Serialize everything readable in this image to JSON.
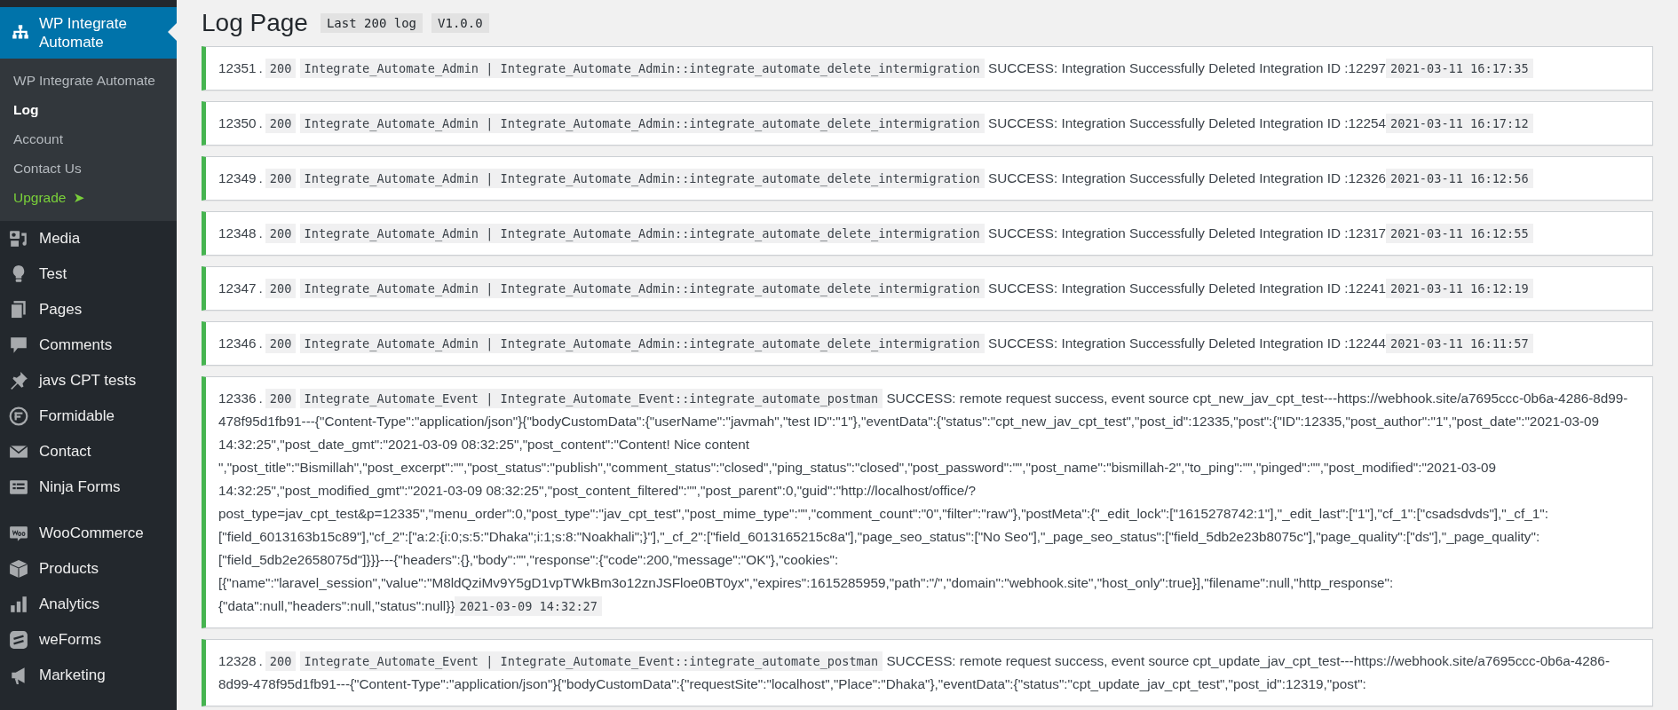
{
  "sidebar": {
    "current": {
      "label": "WP Integrate Automate",
      "selected": true
    },
    "submenu": [
      {
        "label": "WP Integrate Automate",
        "selected": false,
        "kind": "link"
      },
      {
        "label": "Log",
        "selected": true,
        "kind": "link"
      },
      {
        "label": "Account",
        "selected": false,
        "kind": "link"
      },
      {
        "label": "Contact Us",
        "selected": false,
        "kind": "link"
      },
      {
        "label": "Upgrade",
        "selected": false,
        "kind": "upgrade",
        "arrow": "➤"
      }
    ],
    "items": [
      {
        "label": "Media",
        "selected": false
      },
      {
        "label": "Test",
        "selected": false
      },
      {
        "label": "Pages",
        "selected": false
      },
      {
        "label": "Comments",
        "selected": false
      },
      {
        "label": "javs CPT tests",
        "selected": false
      },
      {
        "label": "Formidable",
        "selected": false
      },
      {
        "label": "Contact",
        "selected": false
      },
      {
        "label": "Ninja Forms",
        "selected": false
      },
      {
        "label": "WooCommerce",
        "selected": false,
        "separator_before": true
      },
      {
        "label": "Products",
        "selected": false
      },
      {
        "label": "Analytics",
        "selected": false
      },
      {
        "label": "weForms",
        "selected": false
      },
      {
        "label": "Marketing",
        "selected": false
      }
    ]
  },
  "page": {
    "title": "Log Page",
    "badges": [
      "Last 200 log",
      "V1.0.0"
    ]
  },
  "logs": [
    {
      "id": "12351",
      "sep": ".",
      "code": "200",
      "source": "Integrate_Automate_Admin | Integrate_Automate_Admin::integrate_automate_delete_intermigration",
      "message": "SUCCESS: Integration Successfully Deleted Integration ID :12297",
      "time": "2021-03-11 16:17:35"
    },
    {
      "id": "12350",
      "sep": ".",
      "code": "200",
      "source": "Integrate_Automate_Admin | Integrate_Automate_Admin::integrate_automate_delete_intermigration",
      "message": "SUCCESS: Integration Successfully Deleted Integration ID :12254",
      "time": "2021-03-11 16:17:12"
    },
    {
      "id": "12349",
      "sep": ".",
      "code": "200",
      "source": "Integrate_Automate_Admin | Integrate_Automate_Admin::integrate_automate_delete_intermigration",
      "message": "SUCCESS: Integration Successfully Deleted Integration ID :12326",
      "time": "2021-03-11 16:12:56"
    },
    {
      "id": "12348",
      "sep": ".",
      "code": "200",
      "source": "Integrate_Automate_Admin | Integrate_Automate_Admin::integrate_automate_delete_intermigration",
      "message": "SUCCESS: Integration Successfully Deleted Integration ID :12317",
      "time": "2021-03-11 16:12:55"
    },
    {
      "id": "12347",
      "sep": ".",
      "code": "200",
      "source": "Integrate_Automate_Admin | Integrate_Automate_Admin::integrate_automate_delete_intermigration",
      "message": "SUCCESS: Integration Successfully Deleted Integration ID :12241",
      "time": "2021-03-11 16:12:19"
    },
    {
      "id": "12346",
      "sep": ".",
      "code": "200",
      "source": "Integrate_Automate_Admin | Integrate_Automate_Admin::integrate_automate_delete_intermigration",
      "message": "SUCCESS: Integration Successfully Deleted Integration ID :12244",
      "time": "2021-03-11 16:11:57"
    },
    {
      "id": "12336",
      "sep": ".",
      "code": "200",
      "source": "Integrate_Automate_Event | Integrate_Automate_Event::integrate_automate_postman",
      "message": "SUCCESS: remote request success, event source cpt_new_jav_cpt_test---https://webhook.site/a7695ccc-0b6a-4286-8d99-478f95d1fb91---{\"Content-Type\":\"application/json\"}{\"bodyCustomData\":{\"userName\":\"javmah\",\"test ID\":\"1\"},\"eventData\":{\"status\":\"cpt_new_jav_cpt_test\",\"post_id\":12335,\"post\":{\"ID\":12335,\"post_author\":\"1\",\"post_date\":\"2021-03-09 14:32:25\",\"post_date_gmt\":\"2021-03-09 08:32:25\",\"post_content\":\"Content! Nice content\n\",\"post_title\":\"Bismillah\",\"post_excerpt\":\"\",\"post_status\":\"publish\",\"comment_status\":\"closed\",\"ping_status\":\"closed\",\"post_password\":\"\",\"post_name\":\"bismillah-2\",\"to_ping\":\"\",\"pinged\":\"\",\"post_modified\":\"2021-03-09 14:32:25\",\"post_modified_gmt\":\"2021-03-09 08:32:25\",\"post_content_filtered\":\"\",\"post_parent\":0,\"guid\":\"http://localhost/office/?post_type=jav_cpt_test&p=12335\",\"menu_order\":0,\"post_type\":\"jav_cpt_test\",\"post_mime_type\":\"\",\"comment_count\":\"0\",\"filter\":\"raw\"},\"postMeta\":{\"_edit_lock\":[\"1615278742:1\"],\"_edit_last\":[\"1\"],\"cf_1\":[\"csadsdvds\"],\"_cf_1\":[\"field_6013163b15c89\"],\"cf_2\":[\"a:2:{i:0;s:5:\"Dhaka\";i:1;s:8:\"Noakhali\";}\"],\"_cf_2\":[\"field_6013165215c8a\"],\"page_seo_status\":[\"No Seo\"],\"_page_seo_status\":[\"field_5db2e23b8075c\"],\"page_quality\":[\"ds\"],\"_page_quality\":[\"field_5db2e2658075d\"]}}}---{\"headers\":{},\"body\":\"\",\"response\":{\"code\":200,\"message\":\"OK\"},\"cookies\":[{\"name\":\"laravel_session\",\"value\":\"M8ldQziMv9Y5gD1vpTWkBm3o12znJSFloe0BT0yx\",\"expires\":1615285959,\"path\":\"/\",\"domain\":\"webhook.site\",\"host_only\":true}],\"filename\":null,\"http_response\":{\"data\":null,\"headers\":null,\"status\":null}}",
      "time": "2021-03-09 14:32:27"
    },
    {
      "id": "12328",
      "sep": ".",
      "code": "200",
      "source": "Integrate_Automate_Event | Integrate_Automate_Event::integrate_automate_postman",
      "message": "SUCCESS: remote request success, event source cpt_update_jav_cpt_test---https://webhook.site/a7695ccc-0b6a-4286-8d99-478f95d1fb91---{\"Content-Type\":\"application/json\"}{\"bodyCustomData\":{\"requestSite\":\"localhost\",\"Place\":\"Dhaka\"},\"eventData\":{\"status\":\"cpt_update_jav_cpt_test\",\"post_id\":12319,\"post\":"
    }
  ]
}
